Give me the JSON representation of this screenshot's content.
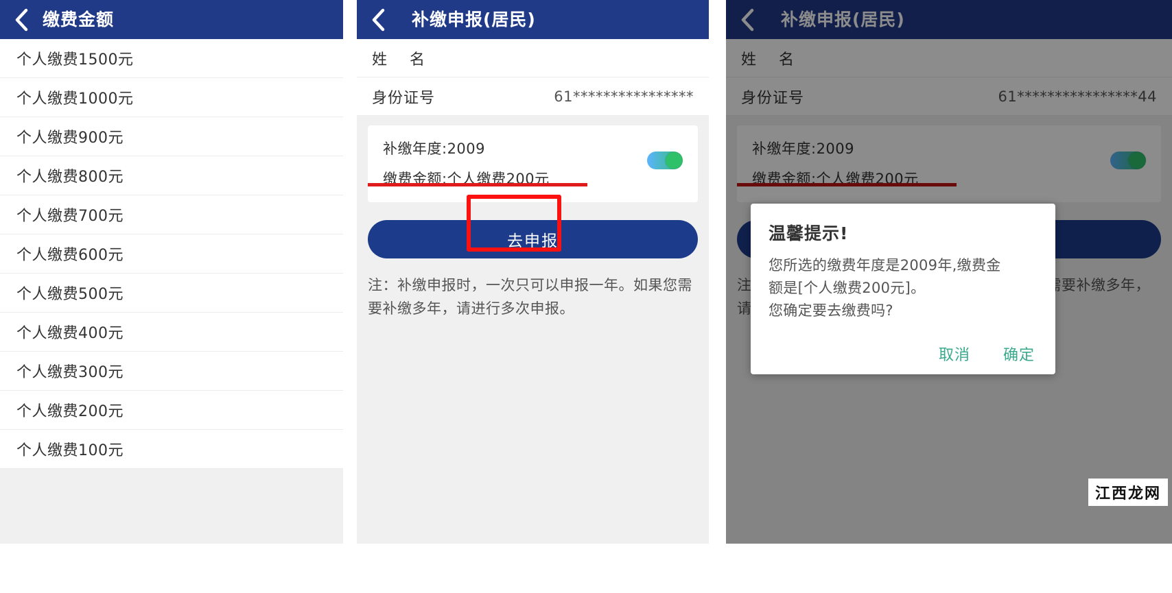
{
  "left_panel": {
    "nav": {
      "back_icon": "chevron-left-icon",
      "title": "缴费金额"
    },
    "items": [
      "个人缴费1500元",
      "个人缴费1000元",
      "个人缴费900元",
      "个人缴费800元",
      "个人缴费700元",
      "个人缴费600元",
      "个人缴费500元",
      "个人缴费400元",
      "个人缴费300元",
      "个人缴费200元",
      "个人缴费100元"
    ]
  },
  "middle_panel": {
    "nav": {
      "back_icon": "chevron-left-icon",
      "title": "补缴申报(居民)"
    },
    "form": {
      "name_label": "姓    名",
      "name_value": "",
      "id_label": "身份证号",
      "id_value": "61****************"
    },
    "card": {
      "year_line": "补缴年度:2009",
      "amount_line": "缴费金额:个人缴费200元",
      "toggle_on": true
    },
    "submit_label": "去申报",
    "note": "注：补缴申报时，一次只可以申报一年。如果您需要补缴多年，请进行多次申报。"
  },
  "right_panel": {
    "nav": {
      "back_icon": "chevron-left-icon",
      "title": "补缴申报(居民)"
    },
    "form": {
      "name_label": "姓    名",
      "name_value": "",
      "id_label": "身份证号",
      "id_value": "61****************44"
    },
    "card": {
      "year_line": "补缴年度:2009",
      "amount_line": "缴费金额:个人缴费200元",
      "toggle_on": true
    },
    "dialog": {
      "title": "温馨提示!",
      "line1": "您所选的缴费年度是2009年,缴费金",
      "line2": "额是[个人缴费200元]。",
      "line3": "您确定要去缴费吗?",
      "cancel_label": "取消",
      "confirm_label": "确定"
    }
  },
  "watermark": {
    "text": "江西龙网"
  },
  "colors": {
    "nav_blue": "#203a87",
    "button_blue": "#1d3b8b",
    "annotation_red": "#fc1111",
    "dialog_action": "#3aa98c",
    "toggle_green": "#2fc06a"
  }
}
